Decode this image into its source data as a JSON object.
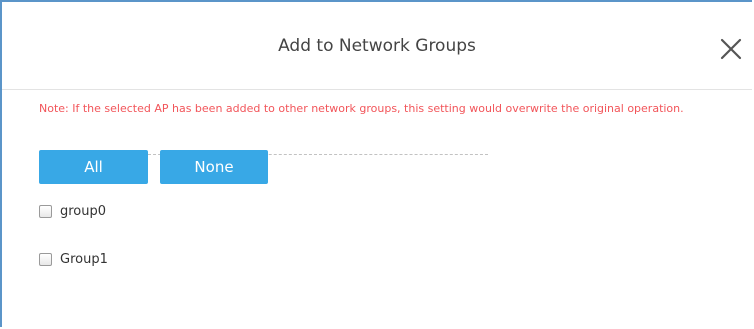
{
  "dialog": {
    "title": "Add to Network Groups",
    "note": "Note: If the selected AP has been added to other network groups, this setting would overwrite the original operation.",
    "buttons": {
      "all_label": "All",
      "none_label": "None"
    },
    "groups": [
      {
        "label": "group0",
        "checked": false
      },
      {
        "label": "Group1",
        "checked": false
      }
    ],
    "colors": {
      "accent": "#38a8e6",
      "note": "#f2555a",
      "border": "#5b95c9"
    },
    "icons": {
      "close": "close-icon"
    }
  }
}
